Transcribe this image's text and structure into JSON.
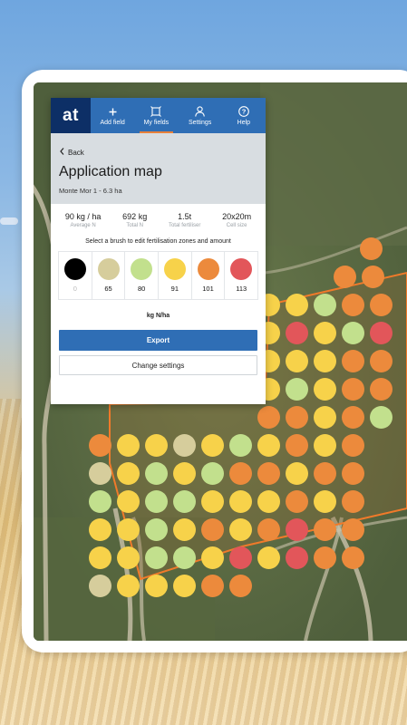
{
  "nav": {
    "logo": "at",
    "items": [
      {
        "label": "Add field",
        "icon": "plus-icon"
      },
      {
        "label": "My fields",
        "icon": "field-outline-icon",
        "active": true
      },
      {
        "label": "Settings",
        "icon": "user-icon"
      },
      {
        "label": "Help",
        "icon": "question-icon"
      }
    ]
  },
  "header": {
    "back_label": "Back",
    "title": "Application map",
    "subtitle": "Monte Mor 1 - 6.3 ha"
  },
  "stats": [
    {
      "value": "90 kg / ha",
      "label": "Average N"
    },
    {
      "value": "692 kg",
      "label": "Total N"
    },
    {
      "value": "1.5t",
      "label": "Total fertiliser"
    },
    {
      "value": "20x20m",
      "label": "Cell size"
    }
  ],
  "brush_hint": "Select a brush to edit fertilisation zones and amount",
  "brushes": [
    {
      "value": "0",
      "color": "#000000"
    },
    {
      "value": "65",
      "color": "#d6cd9c"
    },
    {
      "value": "80",
      "color": "#c2e08d"
    },
    {
      "value": "91",
      "color": "#f7d24a"
    },
    {
      "value": "101",
      "color": "#ec8a3c"
    },
    {
      "value": "113",
      "color": "#e2565a"
    }
  ],
  "unit_label": "kg N/ha",
  "export_label": "Export",
  "change_settings_label": "Change settings",
  "map": {
    "dot_colors": {
      "B": "#d6cd9c",
      "G": "#c2e08d",
      "Y": "#f7d24a",
      "O": "#ec8a3c",
      "R": "#e2565a"
    },
    "rows": [
      {
        "pattern": "O"
      },
      {
        "pattern": "OO"
      },
      {
        "pattern": "YYGOO"
      },
      {
        "pattern": "YRYGR"
      },
      {
        "pattern": "YYYOO"
      },
      {
        "pattern": "YGYOO"
      },
      {
        "pattern": "OOYOG"
      },
      {
        "pattern": "OYYBYGYOYO"
      },
      {
        "pattern": "BYGYGOOYOO"
      },
      {
        "pattern": "GYGGYYYOYO"
      },
      {
        "pattern": "YYGYOYOROO"
      },
      {
        "pattern": "YYGGYRYROO"
      },
      {
        "pattern": "BYYYOO"
      }
    ]
  }
}
